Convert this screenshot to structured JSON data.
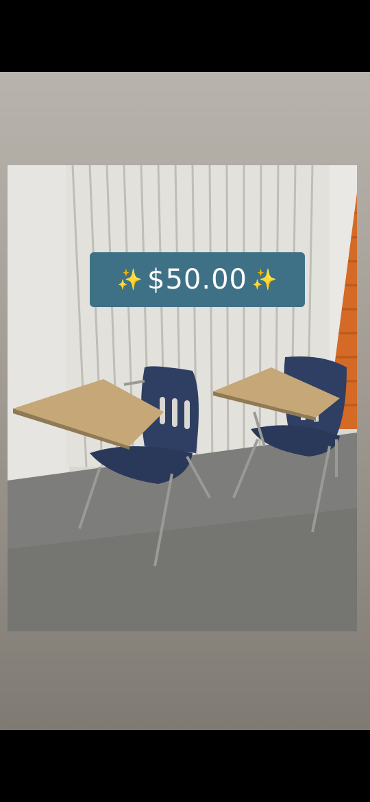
{
  "listing": {
    "price": "$50.00",
    "sparkle_icon": "sparkles-icon"
  },
  "photo": {
    "subject_icon": "classroom-desk-chairs-photo"
  },
  "colors": {
    "badge_bg": "#3f7186",
    "chair_seat": "#2f3f63",
    "desk_top": "#c6a777",
    "frame_bg": "#a29c94"
  }
}
